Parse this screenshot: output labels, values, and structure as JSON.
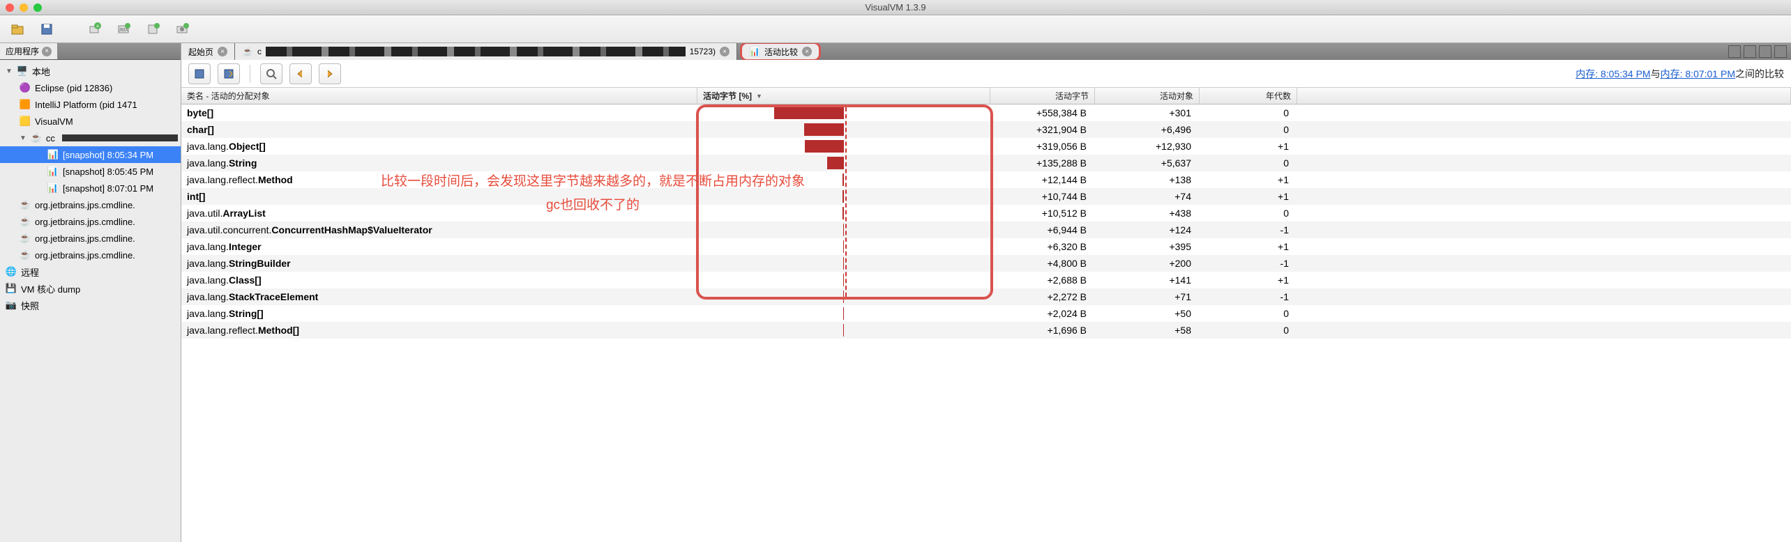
{
  "window": {
    "title": "VisualVM 1.3.9"
  },
  "sidebar": {
    "tab_label": "应用程序",
    "tree": {
      "local_label": "本地",
      "apps": [
        {
          "label": "Eclipse (pid 12836)",
          "icon": "eclipse"
        },
        {
          "label": "IntelliJ Platform (pid 1471",
          "icon": "intellij"
        },
        {
          "label": "VisualVM",
          "icon": "visualvm"
        }
      ],
      "cc_label": "cc",
      "snapshots": [
        {
          "label": "[snapshot] 8:05:34 PM",
          "selected": true
        },
        {
          "label": "[snapshot] 8:05:45 PM",
          "selected": false
        },
        {
          "label": "[snapshot] 8:07:01 PM",
          "selected": false
        }
      ],
      "cmdline": [
        "org.jetbrains.jps.cmdline.",
        "org.jetbrains.jps.cmdline.",
        "org.jetbrains.jps.cmdline.",
        "org.jetbrains.jps.cmdline."
      ],
      "remote_label": "远程",
      "vmdump_label": "VM 核心 dump",
      "snapshot_label": "快照"
    }
  },
  "main_tabs": {
    "start": "起始页",
    "cc_prefix": "c",
    "cc_suffix": "  15723)",
    "compare": "活动比较"
  },
  "compare_text": {
    "prefix": "",
    "link1": "内存: 8:05:34 PM",
    "mid": "与",
    "link2": "内存: 8:07:01 PM",
    "suffix": "之间的比较"
  },
  "columns": {
    "name": "类名 - 活动的分配对象",
    "pct": "活动字节  [%]",
    "bytes": "活动字节",
    "objs": "活动对象",
    "gen": "年代数"
  },
  "annotation": {
    "line1": "比较一段时间后，会发现这里字节越来越多的，就是不断占用内存的对象",
    "line2": "gc也回收不了的"
  },
  "chart_data": {
    "type": "table",
    "title": "活动比较 — 内存快照差异",
    "columns": [
      "类名",
      "活动字节 [%] (bar ≈ relative)",
      "活动字节",
      "活动对象",
      "年代数"
    ],
    "rows": [
      {
        "name_plain": "",
        "name_bold": "byte[]",
        "bar_pct": 100,
        "bytes": "+558,384 B",
        "objs": "+301",
        "gen": "0"
      },
      {
        "name_plain": "",
        "name_bold": "char[]",
        "bar_pct": 57,
        "bytes": "+321,904 B",
        "objs": "+6,496",
        "gen": "0"
      },
      {
        "name_plain": "java.lang.",
        "name_bold": "Object[]",
        "bar_pct": 56,
        "bytes": "+319,056 B",
        "objs": "+12,930",
        "gen": "+1"
      },
      {
        "name_plain": "java.lang.",
        "name_bold": "String",
        "bar_pct": 24,
        "bytes": "+135,288 B",
        "objs": "+5,637",
        "gen": "0"
      },
      {
        "name_plain": "java.lang.reflect.",
        "name_bold": "Method",
        "bar_pct": 2,
        "bytes": "+12,144 B",
        "objs": "+138",
        "gen": "+1"
      },
      {
        "name_plain": "",
        "name_bold": "int[]",
        "bar_pct": 2,
        "bytes": "+10,744 B",
        "objs": "+74",
        "gen": "+1"
      },
      {
        "name_plain": "java.util.",
        "name_bold": "ArrayList",
        "bar_pct": 2,
        "bytes": "+10,512 B",
        "objs": "+438",
        "gen": "0"
      },
      {
        "name_plain": "java.util.concurrent.",
        "name_bold": "ConcurrentHashMap$ValueIterator",
        "bar_pct": 1,
        "bytes": "+6,944 B",
        "objs": "+124",
        "gen": "-1"
      },
      {
        "name_plain": "java.lang.",
        "name_bold": "Integer",
        "bar_pct": 1,
        "bytes": "+6,320 B",
        "objs": "+395",
        "gen": "+1"
      },
      {
        "name_plain": "java.lang.",
        "name_bold": "StringBuilder",
        "bar_pct": 1,
        "bytes": "+4,800 B",
        "objs": "+200",
        "gen": "-1"
      },
      {
        "name_plain": "java.lang.",
        "name_bold": "Class[]",
        "bar_pct": 0,
        "bytes": "+2,688 B",
        "objs": "+141",
        "gen": "+1"
      },
      {
        "name_plain": "java.lang.",
        "name_bold": "StackTraceElement",
        "bar_pct": 0,
        "bytes": "+2,272 B",
        "objs": "+71",
        "gen": "-1"
      },
      {
        "name_plain": "java.lang.",
        "name_bold": "String[]",
        "bar_pct": 0,
        "bytes": "+2,024 B",
        "objs": "+50",
        "gen": "0"
      },
      {
        "name_plain": "java.lang.reflect.",
        "name_bold": "Method[]",
        "bar_pct": 0,
        "bytes": "+1,696 B",
        "objs": "+58",
        "gen": "0"
      }
    ]
  }
}
